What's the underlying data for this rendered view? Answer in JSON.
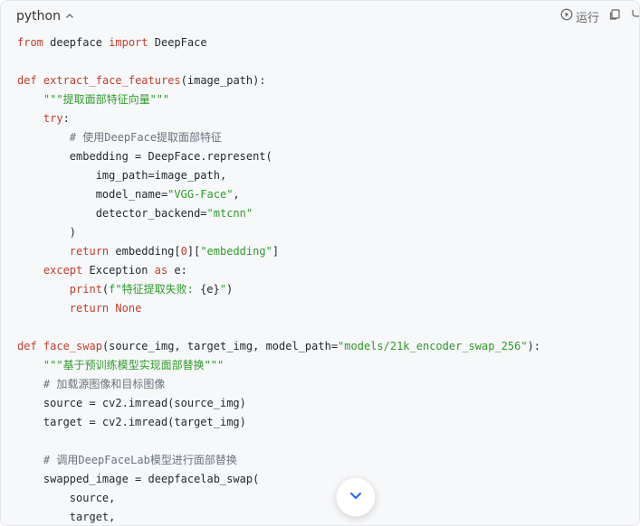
{
  "header": {
    "language": "python",
    "run_label": "运行"
  },
  "code_lines": [
    [
      [
        "t-kw",
        "from"
      ],
      [
        "t-plain",
        " deepface "
      ],
      [
        "t-kw",
        "import"
      ],
      [
        "t-plain",
        " DeepFace"
      ]
    ],
    [],
    [
      [
        "t-kw",
        "def"
      ],
      [
        "t-plain",
        " "
      ],
      [
        "t-fn",
        "extract_face_features"
      ],
      [
        "t-plain",
        "(image_path):"
      ]
    ],
    [
      [
        "t-plain",
        "    "
      ],
      [
        "t-str",
        "\"\"\"提取面部特征向量\"\"\""
      ]
    ],
    [
      [
        "t-plain",
        "    "
      ],
      [
        "t-kw",
        "try"
      ],
      [
        "t-plain",
        ":"
      ]
    ],
    [
      [
        "t-plain",
        "        "
      ],
      [
        "t-cm",
        "# 使用DeepFace提取面部特征"
      ]
    ],
    [
      [
        "t-plain",
        "        embedding = DeepFace.represent("
      ]
    ],
    [
      [
        "t-plain",
        "            img_path=image_path,"
      ]
    ],
    [
      [
        "t-plain",
        "            model_name="
      ],
      [
        "t-str",
        "\"VGG-Face\""
      ],
      [
        "t-plain",
        ","
      ]
    ],
    [
      [
        "t-plain",
        "            detector_backend="
      ],
      [
        "t-str",
        "\"mtcnn\""
      ]
    ],
    [
      [
        "t-plain",
        "        )"
      ]
    ],
    [
      [
        "t-plain",
        "        "
      ],
      [
        "t-kw",
        "return"
      ],
      [
        "t-plain",
        " embedding["
      ],
      [
        "t-num",
        "0"
      ],
      [
        "t-plain",
        "]["
      ],
      [
        "t-str",
        "\"embedding\""
      ],
      [
        "t-plain",
        "]"
      ]
    ],
    [
      [
        "t-plain",
        "    "
      ],
      [
        "t-kw",
        "except"
      ],
      [
        "t-plain",
        " Exception "
      ],
      [
        "t-kw",
        "as"
      ],
      [
        "t-plain",
        " e:"
      ]
    ],
    [
      [
        "t-plain",
        "        "
      ],
      [
        "t-kw",
        "print"
      ],
      [
        "t-plain",
        "("
      ],
      [
        "t-str",
        "f\"特征提取失败: "
      ],
      [
        "t-plain",
        "{e}"
      ],
      [
        "t-str",
        "\""
      ],
      [
        "t-plain",
        ")"
      ]
    ],
    [
      [
        "t-plain",
        "        "
      ],
      [
        "t-kw",
        "return"
      ],
      [
        "t-plain",
        " "
      ],
      [
        "t-kw",
        "None"
      ]
    ],
    [],
    [
      [
        "t-kw",
        "def"
      ],
      [
        "t-plain",
        " "
      ],
      [
        "t-fn",
        "face_swap"
      ],
      [
        "t-plain",
        "(source_img, target_img, model_path="
      ],
      [
        "t-str",
        "\"models/21k_encoder_swap_256\""
      ],
      [
        "t-plain",
        "):"
      ]
    ],
    [
      [
        "t-plain",
        "    "
      ],
      [
        "t-str",
        "\"\"\"基于预训练模型实现面部替换\"\"\""
      ]
    ],
    [
      [
        "t-plain",
        "    "
      ],
      [
        "t-cm",
        "# 加载源图像和目标图像"
      ]
    ],
    [
      [
        "t-plain",
        "    source = cv2.imread(source_img)"
      ]
    ],
    [
      [
        "t-plain",
        "    target = cv2.imread(target_img)"
      ]
    ],
    [],
    [
      [
        "t-plain",
        "    "
      ],
      [
        "t-cm",
        "# 调用DeepFaceLab模型进行面部替换"
      ]
    ],
    [
      [
        "t-plain",
        "    swapped_image = deepfacelab_swap("
      ]
    ],
    [
      [
        "t-plain",
        "        source,"
      ]
    ],
    [
      [
        "t-plain",
        "        target,"
      ]
    ]
  ],
  "icons": {
    "collapse": "chevron-up-icon",
    "run": "play-circle-icon",
    "copy": "copy-icon",
    "wrap": "wrap-icon",
    "scroll_down": "chevron-down-icon"
  },
  "colors": {
    "keyword": "#c03d2e",
    "string": "#2f9a2a",
    "comment": "#6a737d",
    "accent": "#2563eb",
    "background": "#f7f8fa"
  }
}
